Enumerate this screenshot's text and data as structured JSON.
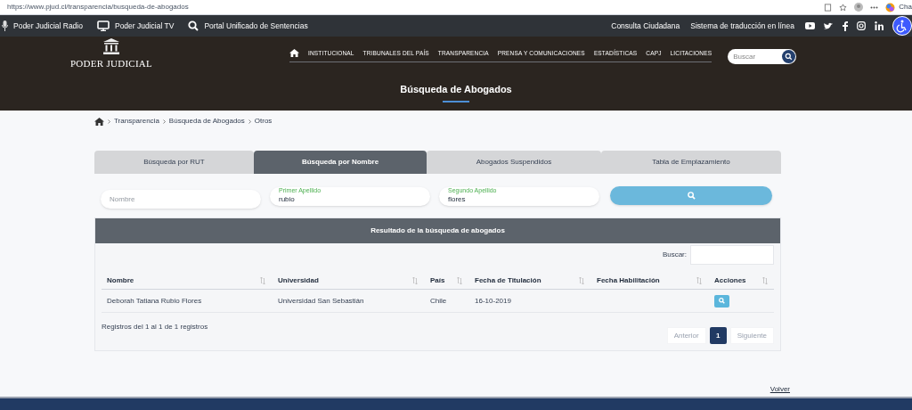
{
  "browser": {
    "url": "https://www.pjud.cl/transparencia/busqueda-de-abogados",
    "extension_label": "Cha"
  },
  "top_bar": {
    "left_links": [
      {
        "label": "Poder Judicial Radio",
        "kind": "mic"
      },
      {
        "label": "Poder Judicial TV",
        "kind": "monitor"
      },
      {
        "label": "Portal Unificado de Sentencias",
        "kind": "search"
      }
    ],
    "right_links": [
      "Consulta Ciudadana",
      "Sistema de traducción en línea"
    ]
  },
  "hero": {
    "logo_text": "PODER JUDICIAL",
    "nav": [
      "INSTITUCIONAL",
      "TRIBUNALES DEL PAÍS",
      "TRANSPARENCIA",
      "PRENSA Y COMUNICACIONES",
      "ESTADÍSTICAS",
      "CAPJ",
      "LICITACIONES"
    ],
    "search_placeholder": "Buscar",
    "title": "Búsqueda de Abogados"
  },
  "breadcrumb": [
    "Transparencia",
    "Búsqueda de Abogados",
    "Otros"
  ],
  "tabs": [
    {
      "label": "Búsqueda por RUT",
      "selected": false
    },
    {
      "label": "Búsqueda por Nombre",
      "selected": true
    },
    {
      "label": "Abogados Suspendidos",
      "selected": false
    },
    {
      "label": "Tabla de Emplazamiento",
      "selected": false
    }
  ],
  "fields": [
    {
      "placeholder": "Nombre"
    },
    {
      "label": "Primer Apellido",
      "value": "rubio"
    },
    {
      "label": "Segundo Apellido",
      "value": "flores"
    }
  ],
  "results": {
    "title": "Resultado de la búsqueda de abogados",
    "search_label": "Buscar:",
    "columns": [
      "Nombre",
      "Universidad",
      "País",
      "Fecha de Titulación",
      "Fecha Habilitación",
      "Acciones"
    ],
    "rows": [
      [
        "Deborah Tatiana Rubio Flores",
        "Universidad San Sebastián",
        "Chile",
        "16-10-2019",
        ""
      ]
    ],
    "summary": "Registros del 1 al 1 de 1 registros",
    "pagination": {
      "previous": {
        "label": "Anterior",
        "disabled": true
      },
      "pages": [
        {
          "label": "1",
          "selected": true
        }
      ],
      "next": {
        "label": "Siguiente",
        "disabled": true
      }
    }
  },
  "back_link": "Volver"
}
